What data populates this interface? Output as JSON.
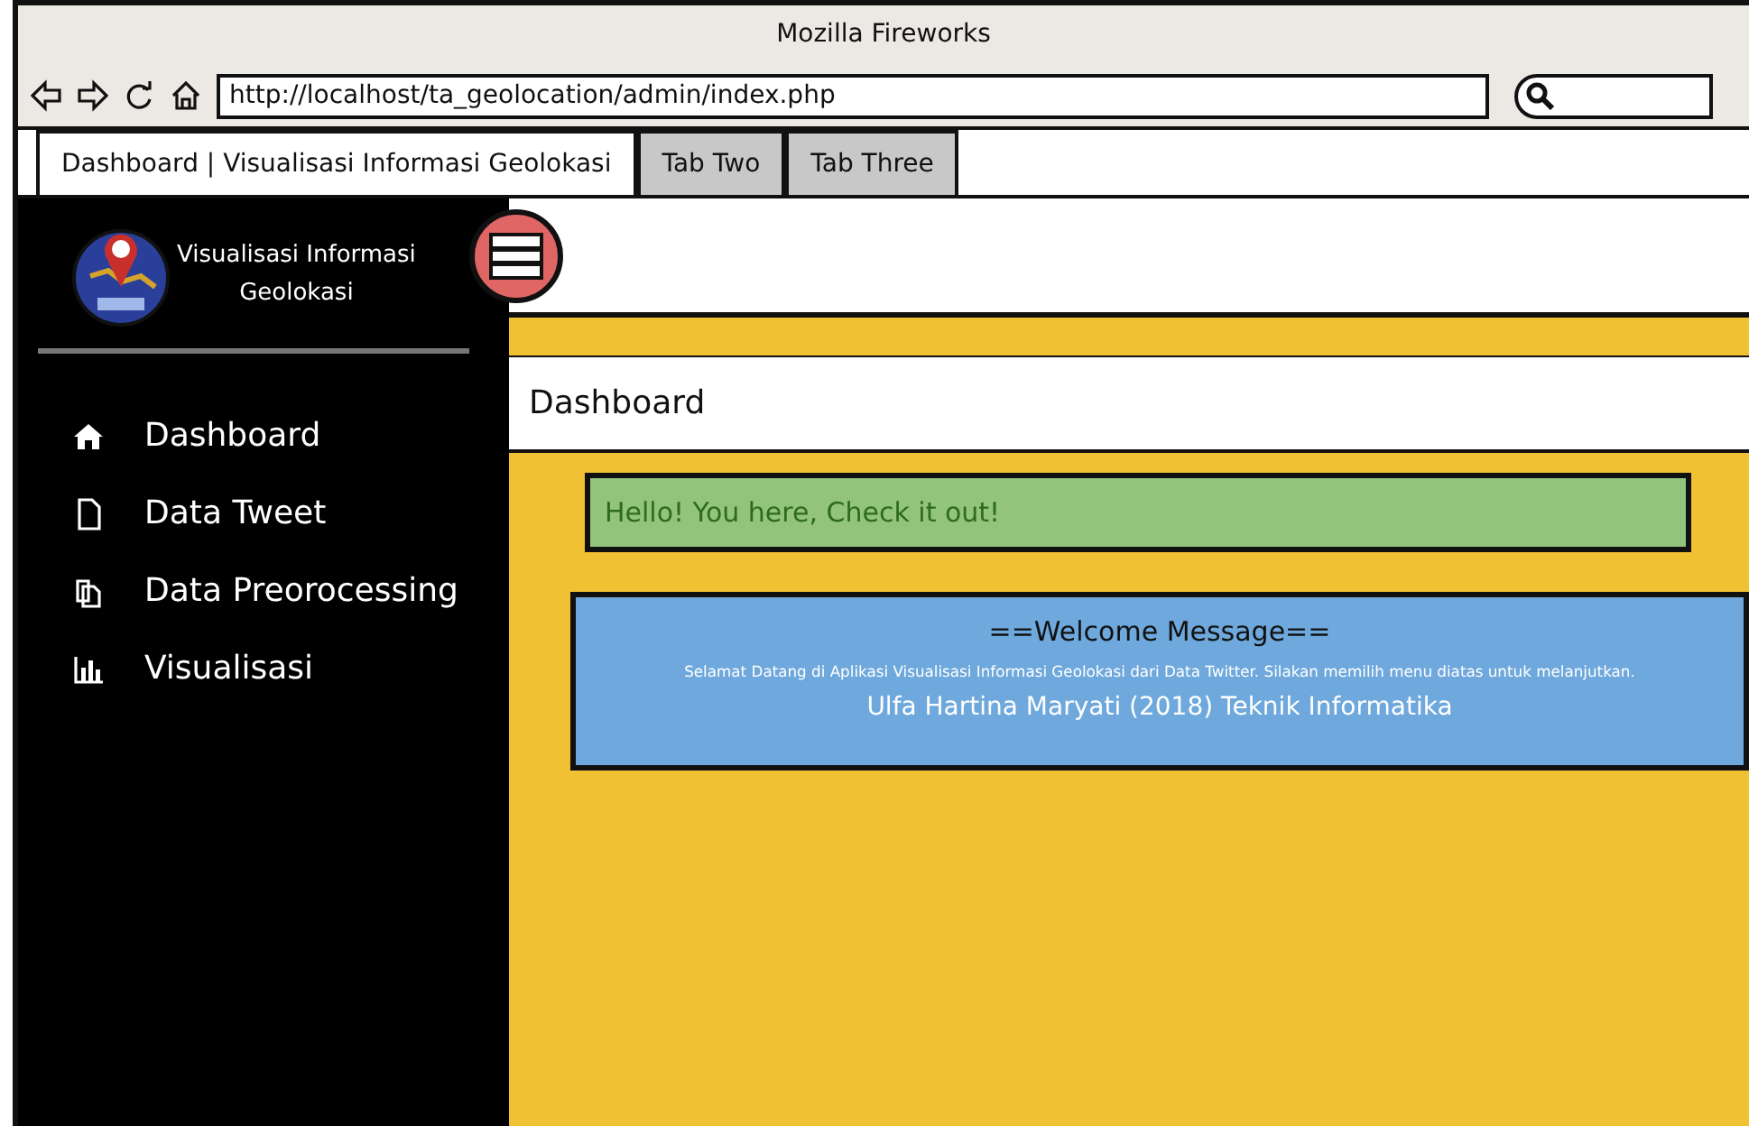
{
  "window": {
    "title": "Mozilla Fireworks"
  },
  "address_bar": {
    "url": "http://localhost/ta_geolocation/admin/index.php"
  },
  "tabs": [
    {
      "label": "Dashboard | Visualisasi Informasi Geolokasi",
      "selected": true
    },
    {
      "label": "Tab Two",
      "selected": false
    },
    {
      "label": "Tab Three",
      "selected": false
    }
  ],
  "sidebar": {
    "brand": [
      "Visualisasi Informasi",
      "Geolokasi"
    ],
    "items": [
      {
        "label": "Dashboard"
      },
      {
        "label": "Data Tweet"
      },
      {
        "label": "Data Preorocessing"
      },
      {
        "label": "Visualisasi"
      }
    ]
  },
  "page_header": "Dashboard",
  "alert": "Hello! You here, Check it out!",
  "welcome": {
    "title": "==Welcome Message==",
    "message": "Selamat Datang di Aplikasi Visualisasi Informasi Geolokasi dari Data Twitter. Silakan memilih menu diatas untuk melanjutkan.",
    "credit": "Ulfa Hartina Maryati (2018) Teknik Informatika"
  }
}
